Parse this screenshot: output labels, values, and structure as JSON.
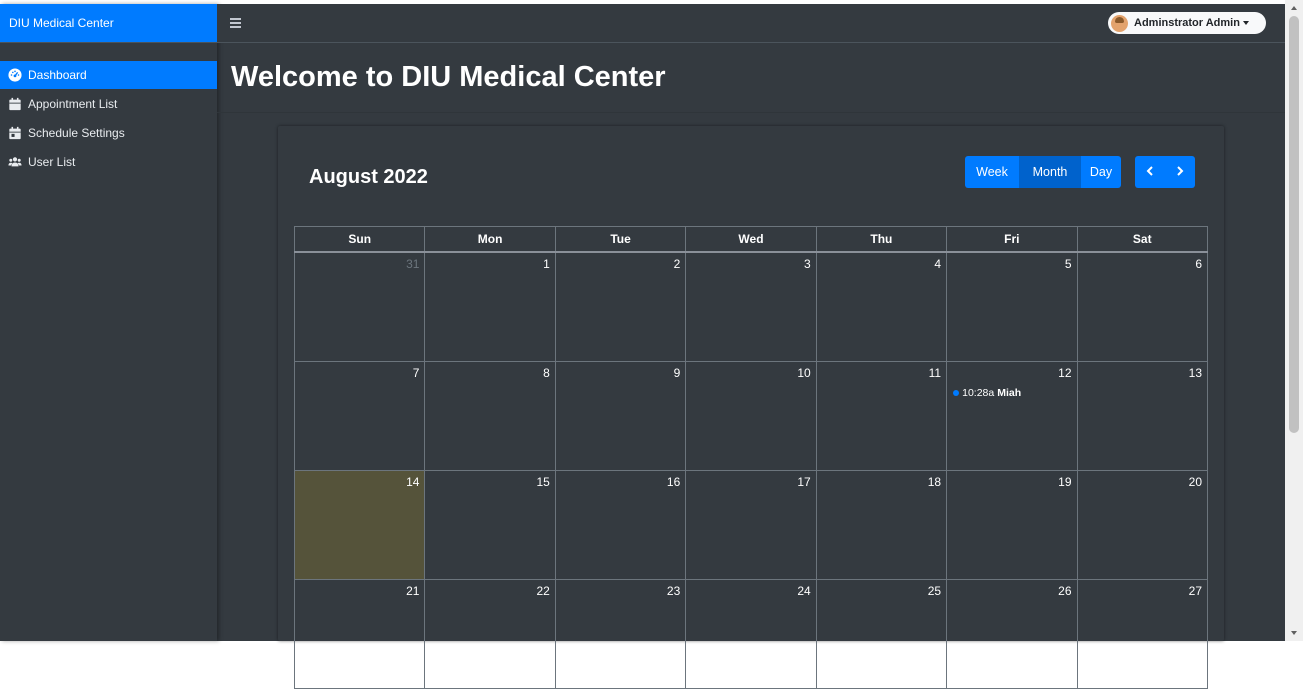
{
  "sidebar": {
    "brand": "DIU Medical Center",
    "items": [
      {
        "label": "Dashboard",
        "icon": "tachometer-icon",
        "active": true
      },
      {
        "label": "Appointment List",
        "icon": "calendar-icon",
        "active": false
      },
      {
        "label": "Schedule Settings",
        "icon": "calendar-day-icon",
        "active": false
      },
      {
        "label": "User List",
        "icon": "users-icon",
        "active": false
      }
    ]
  },
  "topbar": {
    "menu_icon": "hamburger-icon",
    "user_name": "Adminstrator Admin"
  },
  "main": {
    "page_title": "Welcome to DIU Medical Center"
  },
  "calendar": {
    "title": "August 2022",
    "view_buttons": [
      "Week",
      "Month",
      "Day"
    ],
    "active_view": "Month",
    "prev_icon": "chevron-left-icon",
    "next_icon": "chevron-right-icon",
    "weekdays": [
      "Sun",
      "Mon",
      "Tue",
      "Wed",
      "Thu",
      "Fri",
      "Sat"
    ],
    "weeks": [
      [
        "31",
        "1",
        "2",
        "3",
        "4",
        "5",
        "6"
      ],
      [
        "7",
        "8",
        "9",
        "10",
        "11",
        "12",
        "13"
      ],
      [
        "14",
        "15",
        "16",
        "17",
        "18",
        "19",
        "20"
      ],
      [
        "21",
        "22",
        "23",
        "24",
        "25",
        "26",
        "27"
      ]
    ],
    "event": {
      "time": "10:28a",
      "title": "Miah",
      "day": "12"
    },
    "today": "14"
  },
  "colors": {
    "accent": "#007bff",
    "background": "#343a40",
    "today_highlight": "#55533a"
  }
}
